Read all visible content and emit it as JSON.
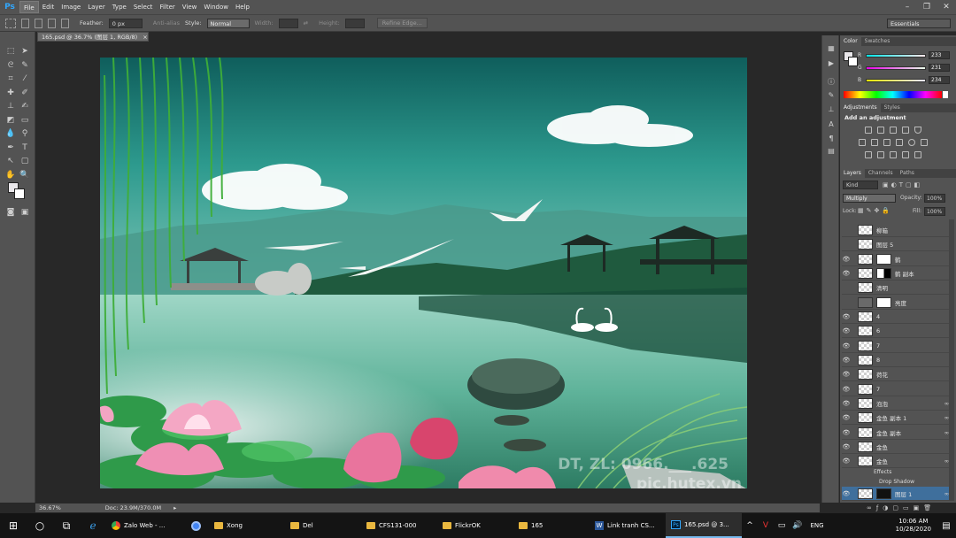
{
  "app": {
    "logo": "Ps"
  },
  "menu": [
    "File",
    "Edit",
    "Image",
    "Layer",
    "Type",
    "Select",
    "Filter",
    "View",
    "Window",
    "Help"
  ],
  "options": {
    "feather_label": "Feather:",
    "feather_value": "0 px",
    "antialias_label": "Anti-alias",
    "style_label": "Style:",
    "style_value": "Normal",
    "width_label": "Width:",
    "height_label": "Height:",
    "refine_edge": "Refine Edge...",
    "workspace": "Essentials"
  },
  "document": {
    "tab_title": "165.psd @ 36.7% (图层 1, RGB/8)",
    "zoom": "36.67%",
    "doc_size": "Doc: 23.9M/370.0M"
  },
  "color_panel": {
    "tabs": [
      "Color",
      "Swatches"
    ],
    "r": "233",
    "g": "231",
    "b": "234",
    "r_label": "R",
    "g_label": "G",
    "b_label": "B"
  },
  "adjustments_panel": {
    "tabs": [
      "Adjustments",
      "Styles"
    ],
    "heading": "Add an adjustment"
  },
  "layers_panel": {
    "tabs": [
      "Layers",
      "Channels",
      "Paths"
    ],
    "kind": "Kind",
    "blend_mode": "Multiply",
    "opacity_label": "Opacity:",
    "opacity": "100%",
    "lock_label": "Lock:",
    "fill_label": "Fill:",
    "fill": "100%",
    "layers": [
      {
        "name": "柳箱",
        "visible": false
      },
      {
        "name": "图层 5",
        "visible": false
      },
      {
        "name": "鹤",
        "visible": true,
        "mask": true
      },
      {
        "name": "鹤 副本",
        "visible": true,
        "mask": true
      },
      {
        "name": "清明",
        "visible": false
      },
      {
        "name": "亮度",
        "visible": false,
        "mask": true
      },
      {
        "name": "4",
        "visible": true
      },
      {
        "name": "6",
        "visible": true
      },
      {
        "name": "7",
        "visible": true
      },
      {
        "name": "8",
        "visible": true
      },
      {
        "name": "荷花",
        "visible": true
      },
      {
        "name": "7",
        "visible": true
      },
      {
        "name": "泡泡",
        "visible": true,
        "fx": true
      },
      {
        "name": "金鱼 副本 1",
        "visible": true,
        "fx": true
      },
      {
        "name": "金鱼 副本",
        "visible": true,
        "fx": true
      },
      {
        "name": "金鱼",
        "visible": true
      },
      {
        "name": "金鱼",
        "visible": true,
        "fx": true
      }
    ],
    "effects_label": "Effects",
    "drop_shadow_label": "Drop Shadow",
    "selected_layer": "图层 1"
  },
  "watermark": {
    "line1": "DT, ZL: 0966.___.625",
    "line2": "pic.hutex.vn"
  },
  "taskbar": {
    "apps": [
      {
        "label": "Zalo Web - ...",
        "icon": "chrome-icon"
      },
      {
        "label": "",
        "icon": "chrome-alt-icon"
      },
      {
        "label": "Xong",
        "icon": "folder-icon"
      },
      {
        "label": "Del",
        "icon": "folder-icon"
      },
      {
        "label": "CFS131-000",
        "icon": "folder-icon"
      },
      {
        "label": "FlickrOK",
        "icon": "folder-icon"
      },
      {
        "label": "165",
        "icon": "folder-icon"
      },
      {
        "label": "Link tranh CS...",
        "icon": "word-icon"
      },
      {
        "label": "165.psd @ 3...",
        "icon": "photoshop-icon"
      }
    ],
    "language": "ENG",
    "time": "10:06 AM",
    "date": "10/28/2020"
  }
}
